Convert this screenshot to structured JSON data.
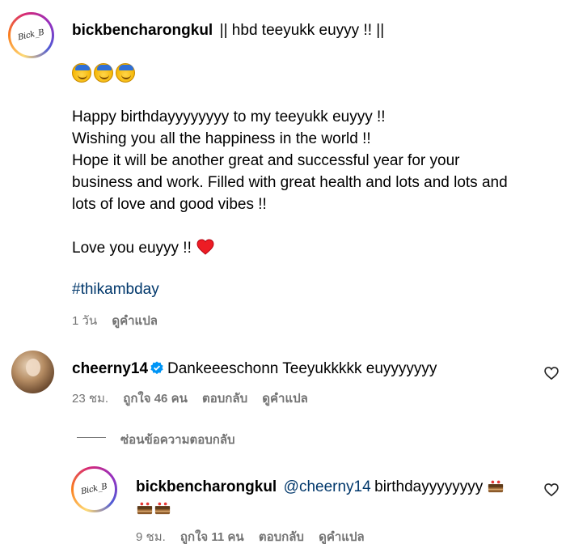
{
  "post": {
    "username": "bickbencharongkul",
    "title_text": "|| hbd teeyukk euyyy !! ||",
    "avatar_text": "Bick_B",
    "emoji_count": 3,
    "lines": [
      "Happy birthdayyyyyyyy to my teeyukk euyyy !!",
      "Wishing you all the happiness in the world !!",
      "Hope it will be another great and successful year for your",
      "business and work. Filled with great health and lots and lots and",
      "lots of love and good vibes !!"
    ],
    "love_line": "Love you euyyy !!",
    "hashtag": "#thikambday",
    "time": "1 วัน",
    "translate": "ดูคำแปล"
  },
  "comment1": {
    "username": "cheerny14",
    "text": "Dankeeeschonn Teeyukkkkk euyyyyyyy",
    "time": "23 ชม.",
    "likes": "ถูกใจ 46 คน",
    "reply": "ตอบกลับ",
    "translate": "ดูคำแปล"
  },
  "hide_replies": "ซ่อนข้อความตอบกลับ",
  "reply1": {
    "username": "bickbencharongkul",
    "mention": "@cheerny14",
    "text": "birthdayyyyyyyy",
    "avatar_text": "Bick_B",
    "time": "9 ชม.",
    "likes": "ถูกใจ 11 คน",
    "reply": "ตอบกลับ",
    "translate": "ดูคำแปล"
  },
  "colors": {
    "link": "#00376b",
    "meta": "#737373",
    "heart": "#ed1c24",
    "verified": "#0095f6"
  }
}
